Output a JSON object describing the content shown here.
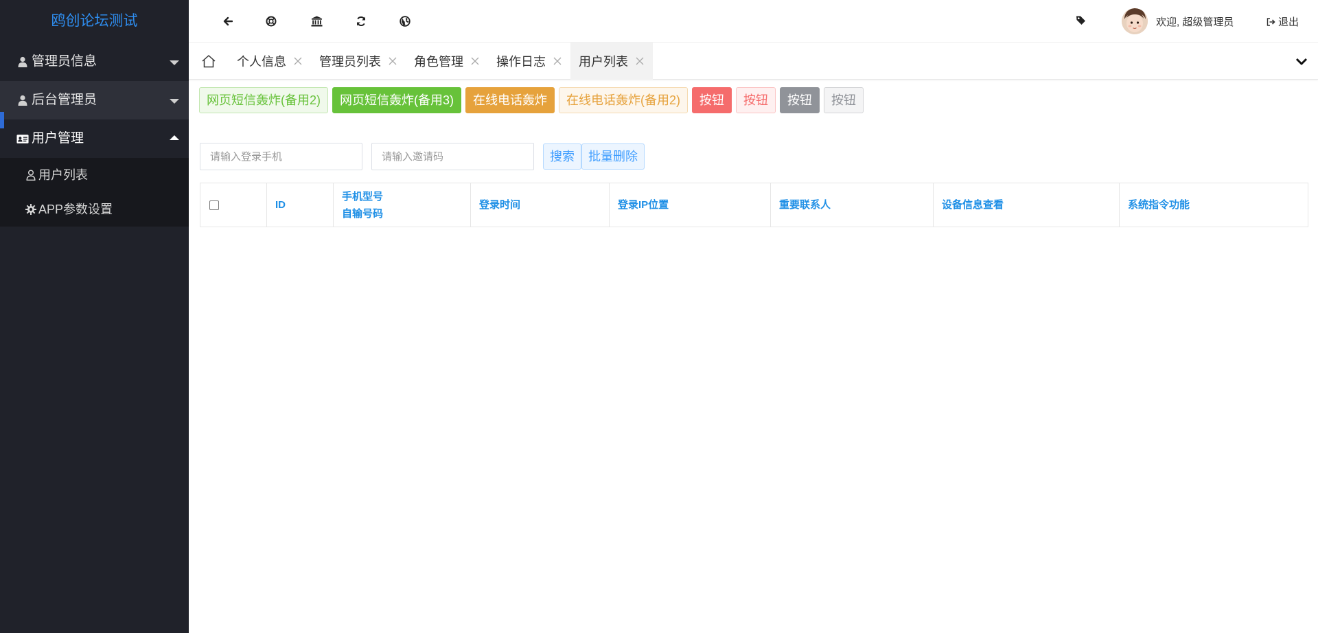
{
  "sidebar": {
    "logo": "鸥创论坛测试",
    "groups": [
      {
        "label": "管理员信息"
      },
      {
        "label": "后台管理员"
      },
      {
        "label": "用户管理"
      }
    ],
    "subitems": [
      {
        "label": "用户列表"
      },
      {
        "label": "APP参数设置"
      }
    ]
  },
  "header": {
    "icons": [
      "arrow-left-icon",
      "lifebuoy-icon",
      "bank-icon",
      "refresh-icon",
      "globe-icon"
    ],
    "welcome": "欢迎, 超级管理员",
    "logout": "退出"
  },
  "tabs": [
    {
      "label": "个人信息"
    },
    {
      "label": "管理员列表"
    },
    {
      "label": "角色管理"
    },
    {
      "label": "操作日志"
    },
    {
      "label": "用户列表"
    }
  ],
  "buttons": [
    {
      "label": "网页短信轰炸(备用2)"
    },
    {
      "label": "网页短信轰炸(备用3)"
    },
    {
      "label": "在线电话轰炸"
    },
    {
      "label": "在线电话轰炸(备用2)"
    },
    {
      "label": "按钮"
    },
    {
      "label": "按钮"
    },
    {
      "label": "按钮"
    },
    {
      "label": "按钮"
    }
  ],
  "search": {
    "phone_placeholder": "请输入登录手机",
    "invite_placeholder": "请输入邀请码",
    "search_label": "搜索",
    "batch_delete_label": "批量删除"
  },
  "table": {
    "columns": [
      {
        "line1": "ID",
        "line2": ""
      },
      {
        "line1": "手机型号",
        "line2": "自输号码"
      },
      {
        "line1": "登录时间",
        "line2": ""
      },
      {
        "line1": "登录IP位置",
        "line2": ""
      },
      {
        "line1": "重要联系人",
        "line2": ""
      },
      {
        "line1": "设备信息查看",
        "line2": ""
      },
      {
        "line1": "系统指令功能",
        "line2": ""
      }
    ],
    "rows": []
  },
  "colors": {
    "sidebar_bg": "#20222a",
    "logo": "#2e8def",
    "header_link": "#1e8fe6",
    "success": "#67c23a",
    "warning": "#e6a23c",
    "danger": "#f56c6c",
    "info": "#909399",
    "primary": "#409eff"
  }
}
